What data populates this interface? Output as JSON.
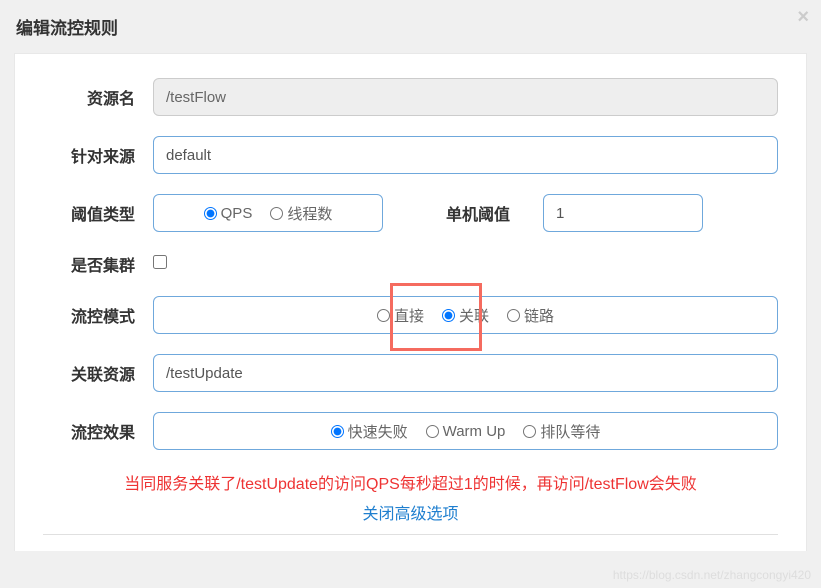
{
  "modal": {
    "title": "编辑流控规则",
    "close": "×"
  },
  "form": {
    "resource_label": "资源名",
    "resource_value": "/testFlow",
    "source_label": "针对来源",
    "source_value": "default",
    "threshold_type_label": "阈值类型",
    "threshold_qps": "QPS",
    "threshold_threads": "线程数",
    "single_threshold_label": "单机阈值",
    "single_threshold_value": "1",
    "cluster_label": "是否集群",
    "mode_label": "流控模式",
    "mode_direct": "直接",
    "mode_relate": "关联",
    "mode_chain": "链路",
    "relate_resource_label": "关联资源",
    "relate_resource_value": "/testUpdate",
    "effect_label": "流控效果",
    "effect_fast": "快速失败",
    "effect_warmup": "Warm Up",
    "effect_queue": "排队等待"
  },
  "note": "当同服务关联了/testUpdate的访问QPS每秒超过1的时候，再访问/testFlow会失败",
  "link": "关闭高级选项",
  "watermark": "https://blog.csdn.net/zhangcongyi420"
}
